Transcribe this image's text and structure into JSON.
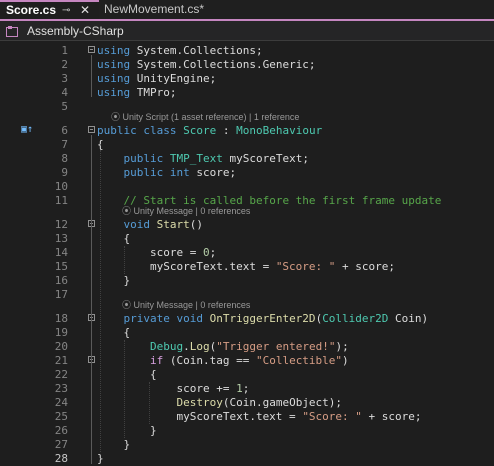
{
  "tabs": [
    {
      "label": "Score.cs",
      "active": true
    },
    {
      "label": "NewMovement.cs*",
      "active": false
    }
  ],
  "pin_glyph": "⊸",
  "close_glyph": "✕",
  "navbar": {
    "project": "Assembly-CSharp"
  },
  "colors": {
    "accent": "#c586c0",
    "keyword": "#569cd6",
    "type": "#4ec9b0",
    "string": "#d69d85",
    "number": "#b5cea8",
    "comment": "#57a64a",
    "method": "#dcdcaa",
    "control": "#d8a0df"
  },
  "lines": [
    {
      "n": "1",
      "tokens": [
        [
          "kw",
          "using"
        ],
        [
          "id",
          " System.Collections;"
        ]
      ]
    },
    {
      "n": "2",
      "tokens": [
        [
          "kw",
          "using"
        ],
        [
          "id",
          " System.Collections.Generic;"
        ]
      ]
    },
    {
      "n": "3",
      "tokens": [
        [
          "kw",
          "using"
        ],
        [
          "id",
          " UnityEngine;"
        ]
      ]
    },
    {
      "n": "4",
      "tokens": [
        [
          "kw",
          "using"
        ],
        [
          "id",
          " TMPro;"
        ]
      ]
    },
    {
      "n": "5",
      "tokens": []
    },
    {
      "n": "6",
      "tokens": [
        [
          "kw",
          "public class "
        ],
        [
          "cls",
          "Score"
        ],
        [
          "id",
          " : "
        ],
        [
          "cls",
          "MonoBehaviour"
        ]
      ]
    },
    {
      "n": "7",
      "tokens": [
        [
          "id",
          "{"
        ]
      ]
    },
    {
      "n": "8",
      "tokens": [
        [
          "id",
          "    "
        ],
        [
          "kw",
          "public "
        ],
        [
          "cls",
          "TMP_Text"
        ],
        [
          "id",
          " myScoreText;"
        ]
      ]
    },
    {
      "n": "9",
      "tokens": [
        [
          "id",
          "    "
        ],
        [
          "kw",
          "public int"
        ],
        [
          "id",
          " score;"
        ]
      ]
    },
    {
      "n": "10",
      "tokens": []
    },
    {
      "n": "11",
      "tokens": [
        [
          "id",
          "    "
        ],
        [
          "cm",
          "// Start is called before the first frame update"
        ]
      ]
    },
    {
      "n": "12",
      "tokens": [
        [
          "id",
          "    "
        ],
        [
          "kw",
          "void "
        ],
        [
          "mth",
          "Start"
        ],
        [
          "id",
          "()"
        ]
      ]
    },
    {
      "n": "13",
      "tokens": [
        [
          "id",
          "    {"
        ]
      ]
    },
    {
      "n": "14",
      "tokens": [
        [
          "id",
          "        score = "
        ],
        [
          "num",
          "0"
        ],
        [
          "id",
          ";"
        ]
      ]
    },
    {
      "n": "15",
      "tokens": [
        [
          "id",
          "        myScoreText.text = "
        ],
        [
          "str",
          "\"Score: \""
        ],
        [
          "id",
          " + score;"
        ]
      ]
    },
    {
      "n": "16",
      "tokens": [
        [
          "id",
          "    }"
        ]
      ]
    },
    {
      "n": "17",
      "tokens": []
    },
    {
      "n": "18",
      "tokens": [
        [
          "id",
          "    "
        ],
        [
          "kw",
          "private void "
        ],
        [
          "mth",
          "OnTriggerEnter2D"
        ],
        [
          "id",
          "("
        ],
        [
          "cls",
          "Collider2D"
        ],
        [
          "id",
          " Coin)"
        ]
      ]
    },
    {
      "n": "19",
      "tokens": [
        [
          "id",
          "    {"
        ]
      ]
    },
    {
      "n": "20",
      "tokens": [
        [
          "id",
          "        "
        ],
        [
          "cls",
          "Debug"
        ],
        [
          "id",
          "."
        ],
        [
          "mth",
          "Log"
        ],
        [
          "id",
          "("
        ],
        [
          "str",
          "\"Trigger entered!\""
        ],
        [
          "id",
          ");"
        ]
      ]
    },
    {
      "n": "21",
      "tokens": [
        [
          "id",
          "        "
        ],
        [
          "ctl",
          "if"
        ],
        [
          "id",
          " (Coin.tag == "
        ],
        [
          "str",
          "\"Collectible\""
        ],
        [
          "id",
          ")"
        ]
      ]
    },
    {
      "n": "22",
      "tokens": [
        [
          "id",
          "        {"
        ]
      ]
    },
    {
      "n": "23",
      "tokens": [
        [
          "id",
          "            score += "
        ],
        [
          "num",
          "1"
        ],
        [
          "id",
          ";"
        ]
      ]
    },
    {
      "n": "24",
      "tokens": [
        [
          "id",
          "            "
        ],
        [
          "mth",
          "Destroy"
        ],
        [
          "id",
          "(Coin.gameObject);"
        ]
      ]
    },
    {
      "n": "25",
      "tokens": [
        [
          "id",
          "            myScoreText.text = "
        ],
        [
          "str",
          "\"Score: \""
        ],
        [
          "id",
          " + score;"
        ]
      ]
    },
    {
      "n": "26",
      "tokens": [
        [
          "id",
          "        }"
        ]
      ]
    },
    {
      "n": "27",
      "tokens": [
        [
          "id",
          "    }"
        ]
      ]
    },
    {
      "n": "28",
      "tokens": [
        [
          "id",
          "}"
        ]
      ]
    }
  ],
  "codelens": [
    {
      "before": "6",
      "text": "Unity Script (1 asset reference) | 1 reference"
    },
    {
      "before": "12",
      "text": "Unity Message | 0 references"
    },
    {
      "before": "18",
      "text": "Unity Message | 0 references"
    }
  ],
  "current_line": "28",
  "indicator_glyph": "▣↑"
}
